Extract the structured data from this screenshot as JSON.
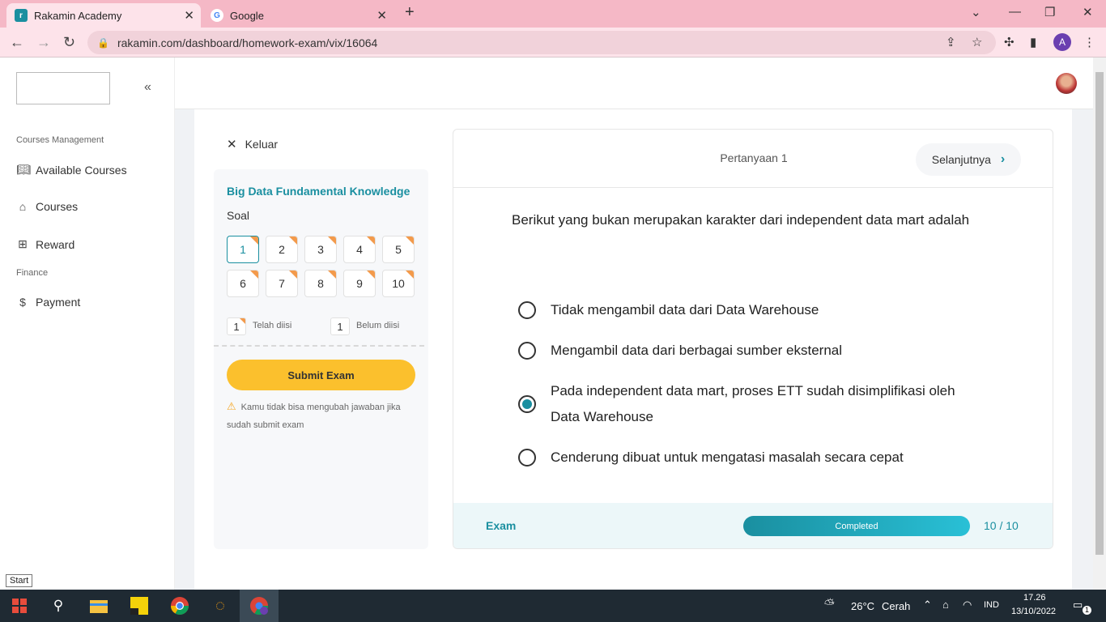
{
  "browser": {
    "tabs": [
      {
        "title": "Rakamin Academy",
        "favicon": "rakamin-logo"
      },
      {
        "title": "Google",
        "favicon": "google-logo"
      }
    ],
    "new_tab": "+",
    "url": "rakamin.com/dashboard/homework-exam/vix/16064",
    "profile_initial": "A"
  },
  "sidebar": {
    "collapse_icon": "«",
    "sections": [
      {
        "title": "Courses Management"
      },
      {
        "title": "Finance"
      }
    ],
    "items": [
      {
        "label": "Available Courses",
        "icon": "book-icon"
      },
      {
        "label": "Courses",
        "icon": "graduation-cap-icon"
      },
      {
        "label": "Reward",
        "icon": "gift-icon"
      },
      {
        "label": "Payment",
        "icon": "dollar-icon"
      }
    ]
  },
  "exam": {
    "exit_label": "Keluar",
    "course_title": "Big Data Fundamental Knowledge",
    "questions_label": "Soal",
    "questions": [
      "1",
      "2",
      "3",
      "4",
      "5",
      "6",
      "7",
      "8",
      "9",
      "10"
    ],
    "active_question": "1",
    "legend": {
      "answered_count": "1",
      "answered_label": "Telah diisi",
      "unanswered_count": "1",
      "unanswered_label": "Belum diisi"
    },
    "submit_label": "Submit Exam",
    "warning_text": "Kamu tidak bisa mengubah jawaban jika sudah submit exam"
  },
  "question": {
    "number_label": "Pertanyaan 1",
    "next_label": "Selanjutnya",
    "text": "Berikut yang bukan merupakan karakter dari independent data mart adalah",
    "options": [
      {
        "text": "Tidak mengambil data dari Data Warehouse",
        "selected": false
      },
      {
        "text": "Mengambil data dari berbagai sumber eksternal",
        "selected": false
      },
      {
        "text": "Pada independent data mart, proses ETT sudah disimplifikasi oleh Data Warehouse",
        "selected": true
      },
      {
        "text": "Cenderung dibuat untuk mengatasi masalah secara cepat",
        "selected": false
      }
    ]
  },
  "footer": {
    "label": "Exam",
    "progress_text": "Completed",
    "progress_fraction": 1.0,
    "count": "10 / 10"
  },
  "taskbar": {
    "start_tooltip": "Start",
    "weather_temp": "26°C",
    "weather_text": "Cerah",
    "lang": "IND",
    "time": "17.26",
    "date": "13/10/2022",
    "notification_count": "1"
  },
  "colors": {
    "accent": "#1a8fa0",
    "submit": "#fbc02d",
    "flag": "#f39a4b",
    "tabbar": "#f5b8c6"
  }
}
